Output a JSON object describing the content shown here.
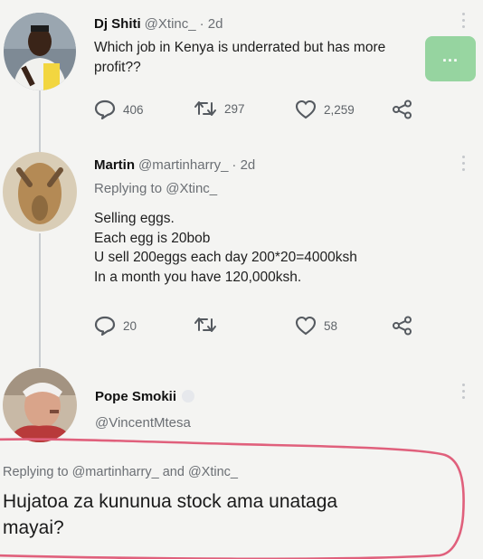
{
  "tweets": [
    {
      "name": "Dj Shiti",
      "handle": "@Xtinc_",
      "time": "· 2d",
      "text_lines": [
        "Which job in Kenya is underrated but has more",
        "profit??"
      ],
      "replies": "406",
      "retweets": "297",
      "likes": "2,259"
    },
    {
      "name": "Martin",
      "handle": "@martinharry_",
      "time": "· 2d",
      "replying_prefix": "Replying to",
      "replying_to": "@Xtinc_",
      "text_lines": [
        "Selling eggs.",
        "Each egg is 20bob",
        "U sell 200eggs each day 200*20=4000ksh",
        "In a month you have 120,000ksh."
      ],
      "replies": "20",
      "likes": "58"
    },
    {
      "name": "Pope Smokii",
      "handle": "@VincentMtesa",
      "replying_prefix": "Replying to",
      "replying_to_1": "@martinharry_",
      "replying_and": "and",
      "replying_to_2": "@Xtinc_",
      "text_lines": [
        "Hujatoa za kununua stock ama unataga",
        "mayai?"
      ]
    }
  ],
  "overlay": {
    "more_label": "..."
  },
  "colors": {
    "circle_annotation": "#e0607c",
    "overlay_button": "#8fd29a",
    "thread_line": "#c9ccd0"
  },
  "icons": [
    "reply-icon",
    "retweet-icon",
    "like-icon",
    "share-icon",
    "more-options-icon",
    "verified-badge-icon"
  ]
}
